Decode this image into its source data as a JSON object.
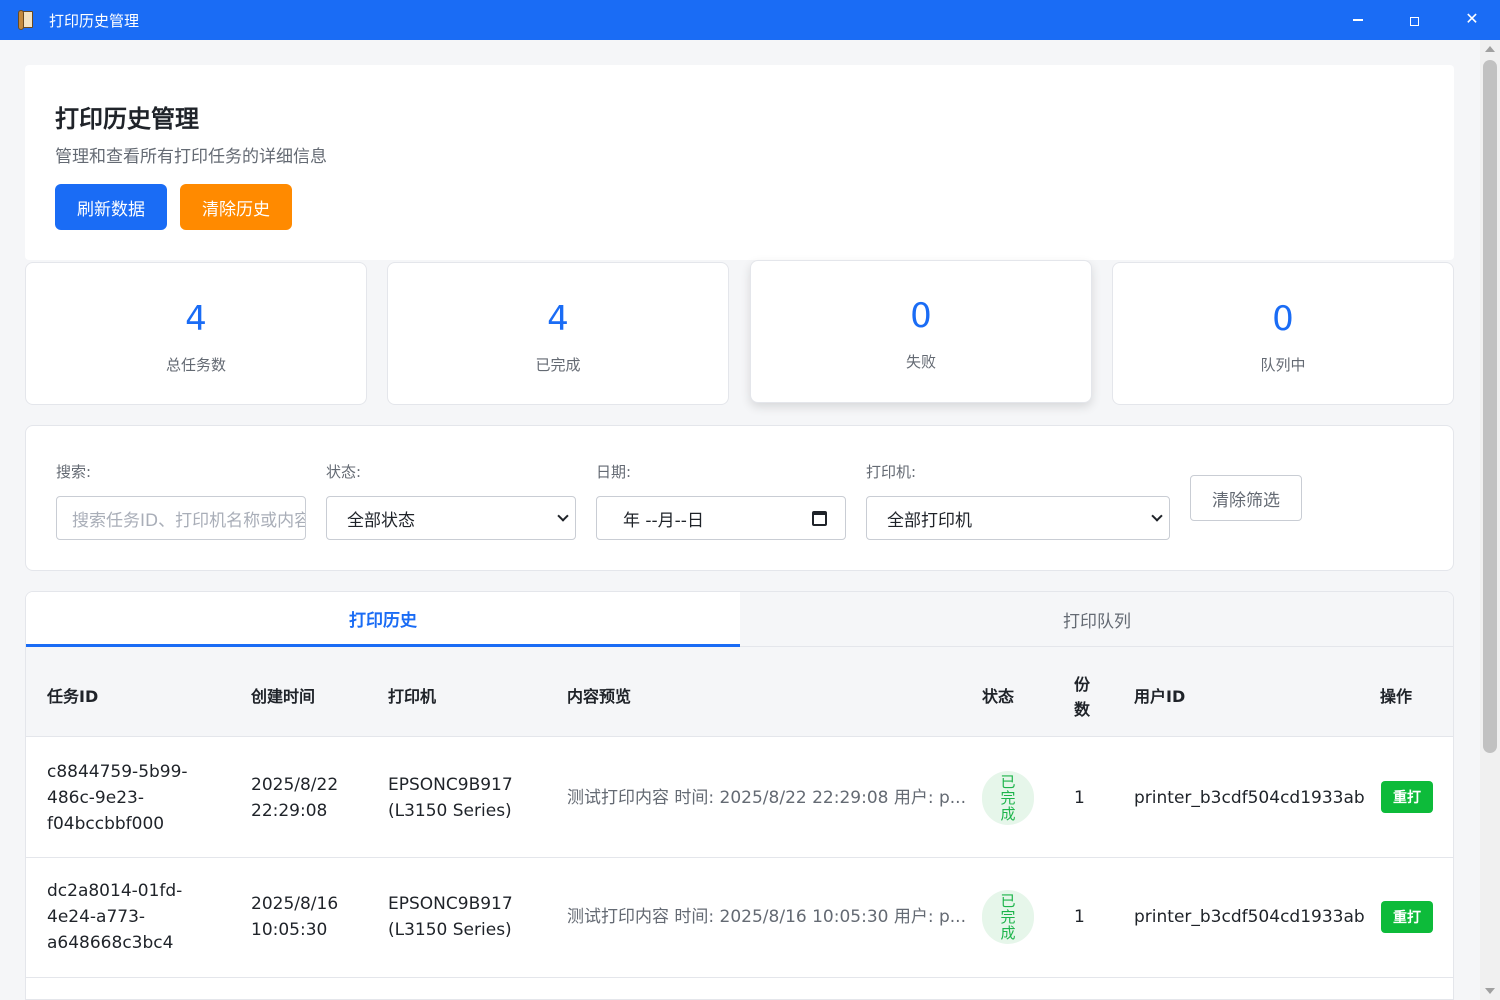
{
  "window": {
    "title": "打印历史管理",
    "minimize_symbol": "",
    "maximize_symbol": "",
    "close_symbol": "✕"
  },
  "header": {
    "title": "打印历史管理",
    "subtitle": "管理和查看所有打印任务的详细信息",
    "refresh_label": "刷新数据",
    "clear_label": "清除历史"
  },
  "stats": [
    {
      "value": "4",
      "label": "总任务数"
    },
    {
      "value": "4",
      "label": "已完成"
    },
    {
      "value": "0",
      "label": "失败"
    },
    {
      "value": "0",
      "label": "队列中"
    }
  ],
  "filters": {
    "search_label": "搜索:",
    "search_placeholder": "搜索任务ID、打印机名称或内容",
    "status_label": "状态:",
    "status_value": "全部状态",
    "date_label": "日期:",
    "date_value": "年 --月--日",
    "printer_label": "打印机:",
    "printer_value": "全部打印机",
    "clear_label": "清除筛选"
  },
  "tabs": [
    {
      "label": "打印历史",
      "active": true
    },
    {
      "label": "打印队列",
      "active": false
    }
  ],
  "table": {
    "headers": {
      "id": "任务ID",
      "created": "创建时间",
      "printer": "打印机",
      "preview": "内容预览",
      "status": "状态",
      "copies_1": "份",
      "copies_2": "数",
      "user": "用户ID",
      "action": "操作"
    },
    "rows": [
      {
        "id_1": "c8844759-5b99-",
        "id_2": "486c-9e23-",
        "id_3": "f04bccbbf000",
        "date": "2025/8/22",
        "time": "22:29:08",
        "printer_1": "EPSONC9B917",
        "printer_2": "(L3150 Series)",
        "preview": "测试打印内容 时间: 2025/8/22 22:29:08 用户: p...",
        "status_1": "已",
        "status_2": "完",
        "status_3": "成",
        "copies": "1",
        "user": "printer_b3cdf504cd1933ab",
        "action": "重打"
      },
      {
        "id_1": "dc2a8014-01fd-",
        "id_2": "4e24-a773-",
        "id_3": "a648668c3bc4",
        "date": "2025/8/16",
        "time": "10:05:30",
        "printer_1": "EPSONC9B917",
        "printer_2": "(L3150 Series)",
        "preview": "测试打印内容 时间: 2025/8/16 10:05:30 用户: p...",
        "status_1": "已",
        "status_2": "完",
        "status_3": "成",
        "copies": "1",
        "user": "printer_b3cdf504cd1933ab",
        "action": "重打"
      }
    ]
  },
  "colors": {
    "accent": "#1a6cf5",
    "warning": "#ff8a00",
    "success": "#0dbb3a",
    "success_bg": "#e6f6ea"
  }
}
